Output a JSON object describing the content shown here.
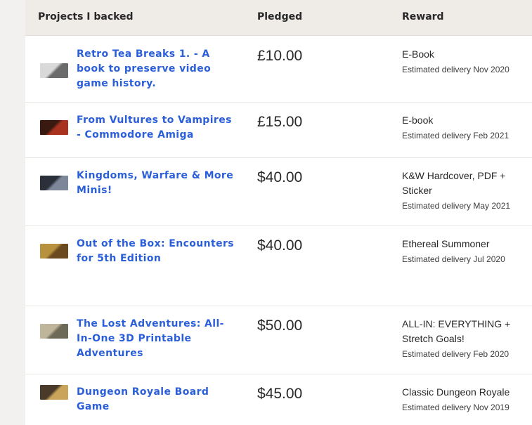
{
  "table": {
    "headers": {
      "project": "Projects I backed",
      "pledged": "Pledged",
      "reward": "Reward"
    },
    "rows": [
      {
        "title": "Retro Tea Breaks 1. - A book to preserve video game history.",
        "amount": "£10.00",
        "reward": "E-Book",
        "delivery": "Estimated delivery Nov 2020",
        "thumb_colors": [
          "#d9d9d9",
          "#6b6b6b"
        ]
      },
      {
        "title": "From Vultures to Vampires - Commodore Amiga",
        "amount": "£15.00",
        "reward": "E-book",
        "delivery": "Estimated delivery Feb 2021",
        "thumb_colors": [
          "#3a1a10",
          "#a8321e"
        ]
      },
      {
        "title": "Kingdoms, Warfare & More Minis!",
        "amount": "$40.00",
        "reward": "K&W Hardcover, PDF + Sticker",
        "delivery": "Estimated delivery May 2021",
        "thumb_colors": [
          "#2a2f3a",
          "#7d8799"
        ]
      },
      {
        "title": "Out of the Box: Encounters for 5th Edition",
        "amount": "$40.00",
        "reward": "Ethereal Summoner",
        "delivery": "Estimated delivery Jul 2020",
        "thumb_colors": [
          "#b7913e",
          "#6b4a1f"
        ]
      },
      {
        "title": "The Lost Adventures: All-In-One 3D Printable Adventures",
        "amount": "$50.00",
        "reward": "ALL-IN: EVERYTHING + Stretch Goals!",
        "delivery": "Estimated delivery Feb 2020",
        "thumb_colors": [
          "#bfb59a",
          "#6e6a58"
        ]
      },
      {
        "title": "Dungeon Royale Board Game",
        "amount": "$45.00",
        "reward": "Classic Dungeon Royale",
        "delivery": "Estimated delivery Nov 2019",
        "thumb_colors": [
          "#4a3a2a",
          "#c9a45a"
        ]
      }
    ]
  }
}
